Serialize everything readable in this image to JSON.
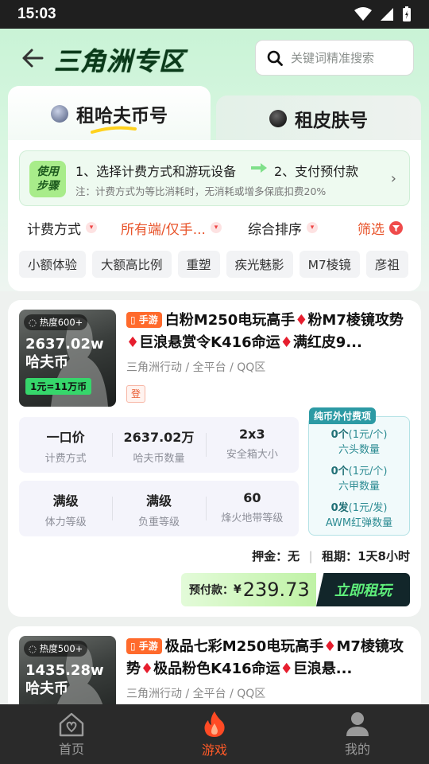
{
  "status": {
    "time": "15:03"
  },
  "header": {
    "title": "三角洲专区",
    "search_placeholder": "关键词精准搜索"
  },
  "tabs": [
    {
      "label": "租哈夫币号",
      "active": true
    },
    {
      "label": "租皮肤号",
      "active": false
    }
  ],
  "steps": {
    "badge_line1": "使用",
    "badge_line2": "步骤",
    "step1": "1、选择计费方式和游玩设备",
    "step2": "2、支付预付款",
    "note": "注：计费方式为等比消耗时，无消耗或增多保底扣费20%"
  },
  "sort": {
    "billing": "计费方式",
    "platform": "所有端/仅手...",
    "order": "综合排序",
    "filter": "筛选"
  },
  "chips": [
    "小额体验",
    "大额高比例",
    "重塑",
    "疾光魅影",
    "M7棱镜",
    "彦祖"
  ],
  "listings": [
    {
      "heat": "热度600+",
      "coins_amount": "2637.02w",
      "coins_unit": "哈夫币",
      "rate": "1元=11万币",
      "tag": "手游",
      "title_parts": [
        "白粉M250电玩高手",
        "粉M7棱镜攻势",
        "巨浪悬赏令K416命运",
        "满红皮9..."
      ],
      "meta": "三角洲行动 / 全平台 / QQ区",
      "reg_badge": "登",
      "stats_row1": [
        {
          "v": "一口价",
          "k": "计费方式"
        },
        {
          "v": "2637.02万",
          "k": "哈夫币数量"
        },
        {
          "v": "2x3",
          "k": "安全箱大小"
        }
      ],
      "stats_row2": [
        {
          "v": "满级",
          "k": "体力等级"
        },
        {
          "v": "满级",
          "k": "负重等级"
        },
        {
          "v": "60",
          "k": "烽火地带等级"
        }
      ],
      "extra_header": "纯币外付费项",
      "extra": [
        {
          "count": "0个",
          "price": "(1元/个)",
          "name": "六头数量"
        },
        {
          "count": "0个",
          "price": "(1元/个)",
          "name": "六甲数量"
        },
        {
          "count": "0发",
          "price": "(1元/发)",
          "name": "AWM红弹数量"
        }
      ],
      "deposit": "押金：无",
      "period": "租期：1天8小时",
      "prepay_label": "预付款：",
      "currency": "¥",
      "prepay_amount": "239.73",
      "cta": "立即租玩"
    },
    {
      "heat": "热度500+",
      "coins_amount": "1435.28w",
      "coins_unit": "哈夫币",
      "tag": "手游",
      "title_parts": [
        "极品七彩M250电玩高手",
        "M7棱镜攻势",
        "极品粉色K416命运",
        "巨浪悬..."
      ],
      "meta": "三角洲行动 / 全平台 / QQ区"
    }
  ],
  "bottom_nav": [
    {
      "label": "首页"
    },
    {
      "label": "游戏",
      "active": true
    },
    {
      "label": "我的"
    }
  ],
  "colors": {
    "accent": "#ff5a28",
    "brand_green": "#36d66b",
    "diamond": "#e61e2e"
  }
}
